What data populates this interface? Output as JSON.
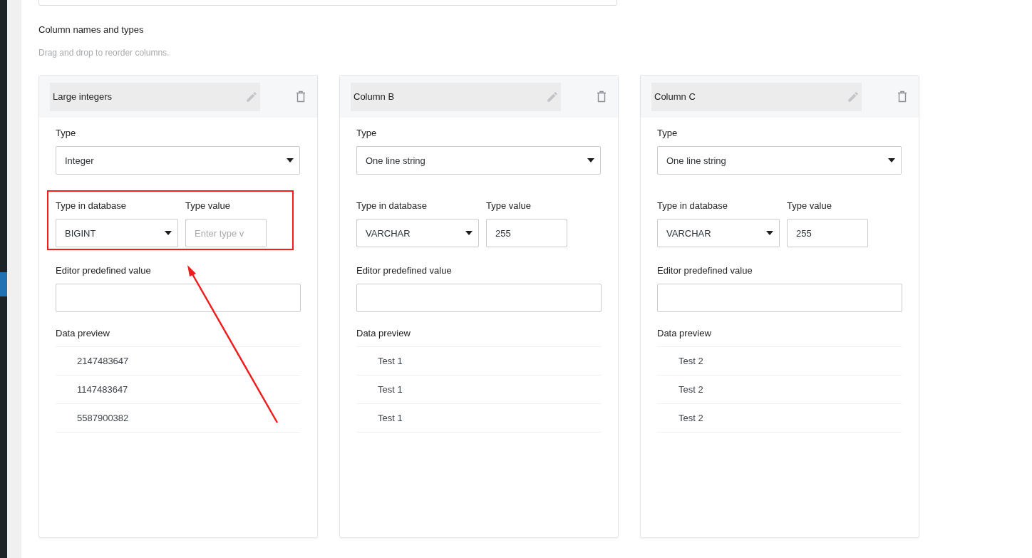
{
  "section": {
    "title": "Column names and types",
    "hint": "Drag and drop to reorder columns."
  },
  "columns": [
    {
      "name": "Large integers",
      "type_label": "Type",
      "type": "Integer",
      "db_type_label": "Type in database",
      "db_type": "BIGINT",
      "type_value_label": "Type value",
      "type_value_placeholder": "Enter type v",
      "editor_label": "Editor predefined value",
      "preview_label": "Data preview",
      "preview": [
        "2147483647",
        "1147483647",
        "5587900382"
      ],
      "annotated": true
    },
    {
      "name": "Column B",
      "type_label": "Type",
      "type": "One line string",
      "db_type_label": "Type in database",
      "db_type": "VARCHAR",
      "type_value_label": "Type value",
      "type_value": "255",
      "editor_label": "Editor predefined value",
      "preview_label": "Data preview",
      "preview": [
        "Test 1",
        "Test 1",
        "Test 1"
      ],
      "annotated": false
    },
    {
      "name": "Column C",
      "type_label": "Type",
      "type": "One line string",
      "db_type_label": "Type in database",
      "db_type": "VARCHAR",
      "type_value_label": "Type value",
      "type_value": "255",
      "editor_label": "Editor predefined value",
      "preview_label": "Data preview",
      "preview": [
        "Test 2",
        "Test 2",
        "Test 2"
      ],
      "annotated": false
    }
  ]
}
